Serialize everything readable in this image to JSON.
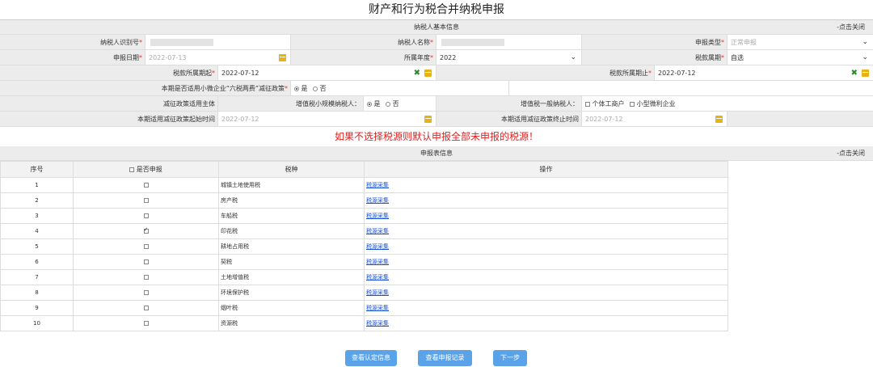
{
  "title": "财产和行为税合并纳税申报",
  "basic_section": {
    "label": "纳税人基本信息",
    "close": "-点击关闭"
  },
  "fields": {
    "taxpayer_id_label": "纳税人识别号",
    "taxpayer_name_label": "纳税人名称",
    "declare_type_label": "申报类型",
    "declare_type_value": "正常申报",
    "declare_date_label": "申报日期",
    "declare_date_value": "2022-07-13",
    "year_label": "所属年度",
    "year_value": "2022",
    "period_label": "税款属期",
    "period_value": "自选",
    "period_start_label": "税款所属期起",
    "period_start_value": "2022-07-12",
    "period_end_label": "税款所属期止",
    "period_end_value": "2022-07-12",
    "six_tax_label": "本期是否适用小微企业“六税两费”减征政策",
    "yes": "是",
    "no": "否",
    "policy_subject_label": "减征政策适用主体",
    "small_scale_label": "增值税小规模纳税人：",
    "general_label": "增值税一般纳税人：",
    "individual_label": "个体工商户",
    "micro_label": "小型微利企业",
    "policy_start_label": "本期适用减征政策起始时间",
    "policy_start_value": "2022-07-12",
    "policy_end_label": "本期适用减征政策终止时间",
    "policy_end_value": "2022-07-12"
  },
  "warning": "如果不选择税源则默认申报全部未申报的税源！",
  "decl_section": {
    "label": "申报表信息",
    "close": "-点击关闭"
  },
  "table": {
    "headers": {
      "no": "序号",
      "is_declare": "是否申报",
      "tax": "税种",
      "op": "操作"
    },
    "rows": [
      {
        "no": "1",
        "tax": "城镇土地使用税",
        "op": "税源采集",
        "checked": false
      },
      {
        "no": "2",
        "tax": "房产税",
        "op": "税源采集",
        "checked": false
      },
      {
        "no": "3",
        "tax": "车船税",
        "op": "税源采集",
        "checked": false
      },
      {
        "no": "4",
        "tax": "印花税",
        "op": "税源采集",
        "checked": true
      },
      {
        "no": "5",
        "tax": "耕地占用税",
        "op": "税源采集",
        "checked": false
      },
      {
        "no": "6",
        "tax": "契税",
        "op": "税源采集",
        "checked": false
      },
      {
        "no": "7",
        "tax": "土地增值税",
        "op": "税源采集",
        "checked": false
      },
      {
        "no": "8",
        "tax": "环境保护税",
        "op": "税源采集",
        "checked": false
      },
      {
        "no": "9",
        "tax": "烟叶税",
        "op": "税源采集",
        "checked": false
      },
      {
        "no": "10",
        "tax": "资源税",
        "op": "税源采集",
        "checked": false
      }
    ]
  },
  "buttons": {
    "auth": "查看认定信息",
    "records": "查看申报记录",
    "next": "下一步"
  },
  "colors": {
    "accent": "#5ba3e8",
    "warning": "#e02020",
    "link": "#1a4fd8",
    "calendar": "#e8b214"
  },
  "icons": {
    "calendar": "calendar-icon",
    "clear": "clear-icon",
    "dropdown": "chevron-down-icon"
  }
}
